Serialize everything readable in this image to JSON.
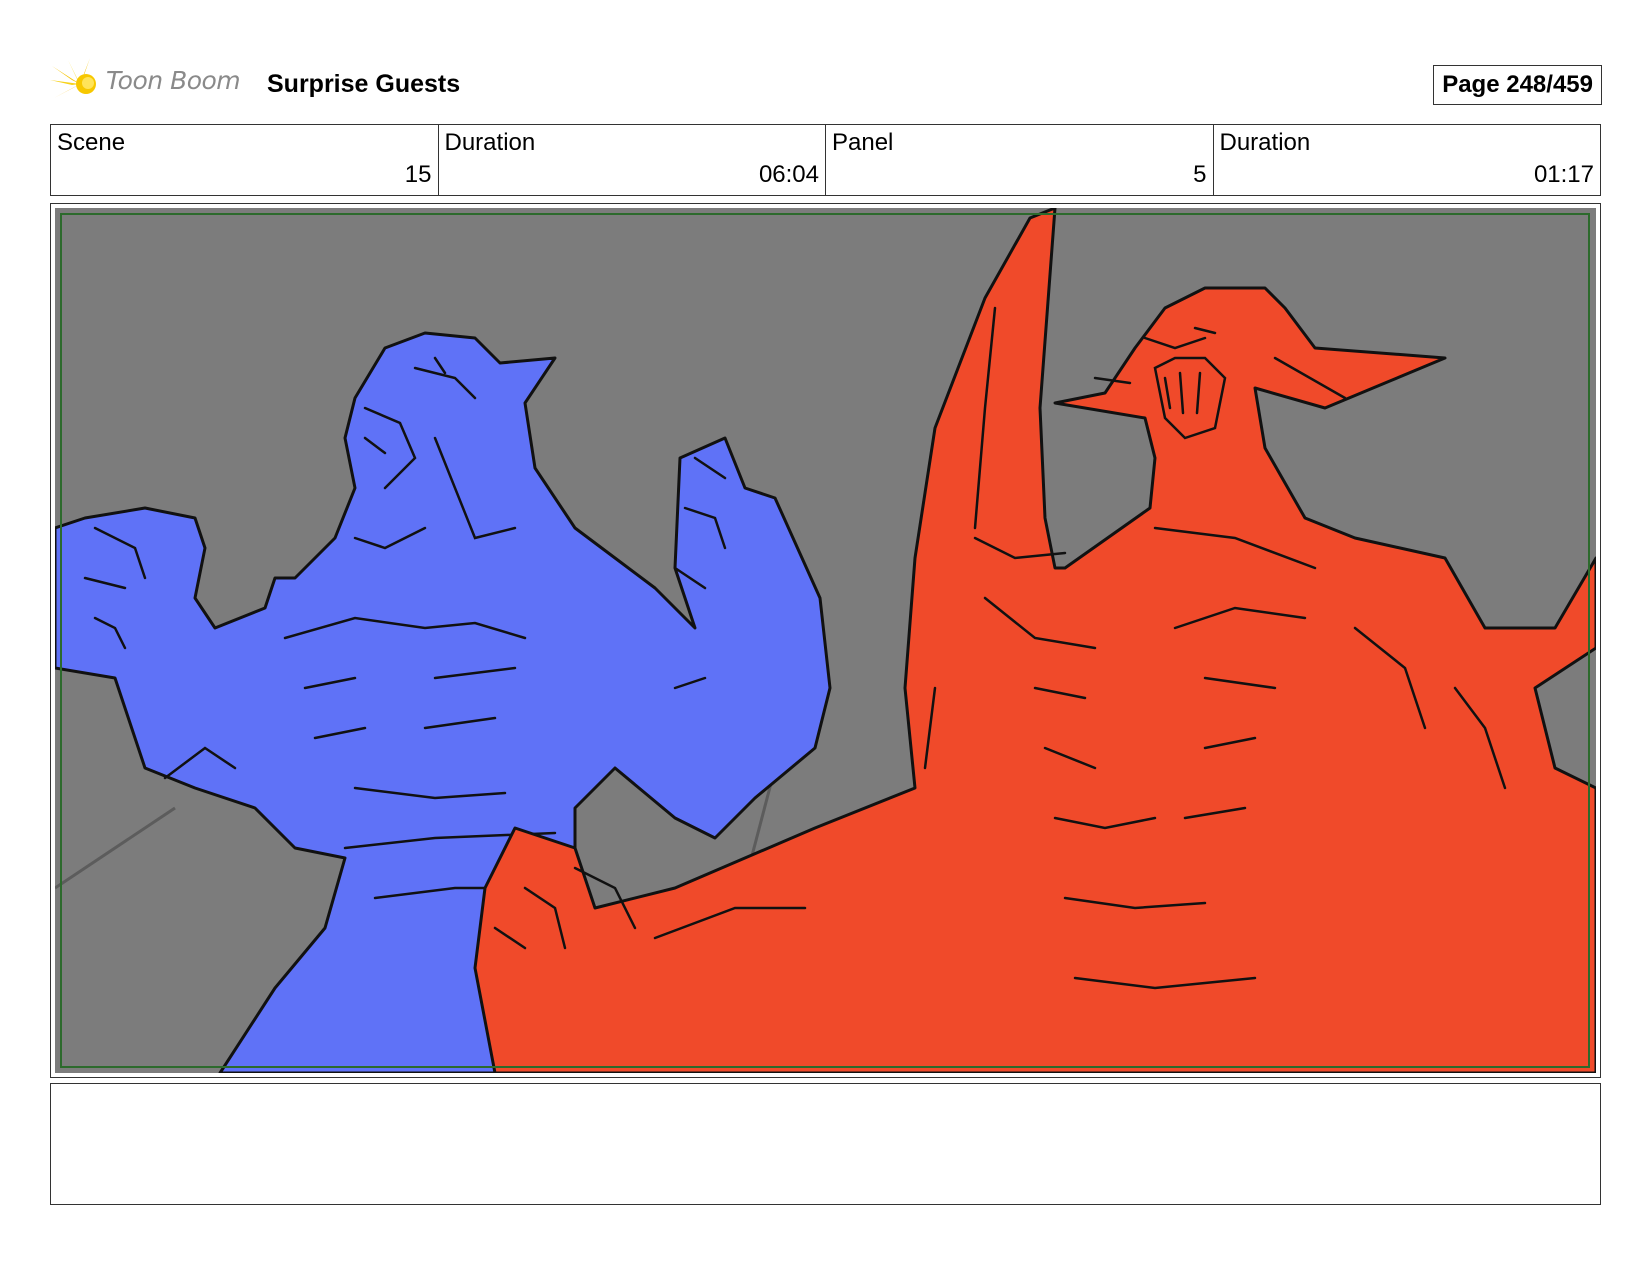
{
  "header": {
    "logo_text": "Toon Boom",
    "project_title": "Surprise Guests",
    "page_label": "Page 248/459"
  },
  "info": {
    "scene": {
      "label": "Scene",
      "value": "15"
    },
    "scene_duration": {
      "label": "Duration",
      "value": "06:04"
    },
    "panel": {
      "label": "Panel",
      "value": "5"
    },
    "panel_duration": {
      "label": "Duration",
      "value": "01:17"
    }
  },
  "panel_image": {
    "colors": {
      "background": "#7c7c7c",
      "blue_figure": "#5f72f7",
      "red_figure": "#f04a2a",
      "line": "#111111",
      "safe_frame": "#2c6a2c"
    }
  },
  "notes": {
    "text": ""
  },
  "icons": {
    "logo": "toon-boom-logo-icon"
  }
}
